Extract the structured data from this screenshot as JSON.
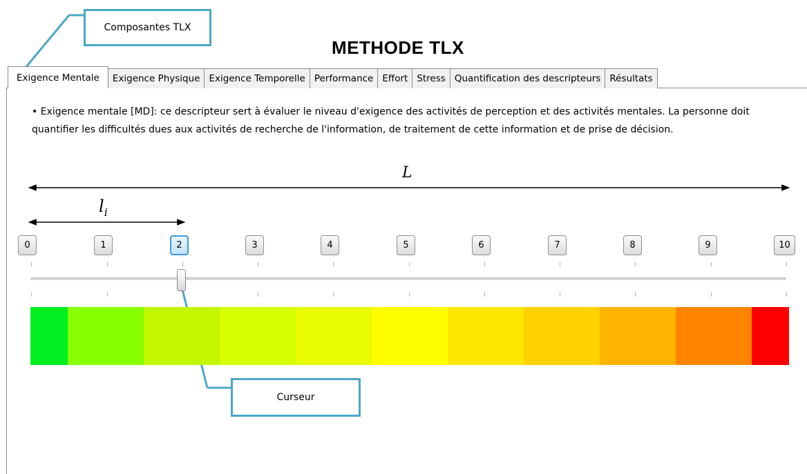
{
  "title": "METHODE TLX",
  "callouts": {
    "tlx_components": "Composantes TLX",
    "cursor": "Curseur"
  },
  "tabs": [
    {
      "label": "Exigence Mentale",
      "active": true
    },
    {
      "label": "Exigence Physique",
      "active": false
    },
    {
      "label": "Exigence Temporelle",
      "active": false
    },
    {
      "label": "Performance",
      "active": false
    },
    {
      "label": "Effort",
      "active": false
    },
    {
      "label": "Stress",
      "active": false
    },
    {
      "label": "Quantification des descripteurs",
      "active": false
    },
    {
      "label": "Résultats",
      "active": false
    }
  ],
  "description": "• Exigence mentale [MD]: ce descripteur sert à évaluer le niveau d'exigence des activités de perception et des activités mentales. La personne doit quantifier les difficultés dues aux activités de recherche de l'information, de traitement de cette information et de prise de décision.",
  "annotations": {
    "total_length": "L",
    "partial_length_base": "l",
    "partial_length_sub": "i"
  },
  "scale": {
    "labels": [
      "0",
      "1",
      "2",
      "3",
      "4",
      "5",
      "6",
      "7",
      "8",
      "9",
      "10"
    ],
    "selected": "2",
    "slider_value": 2,
    "slider_min": 0,
    "slider_max": 10
  },
  "colors": {
    "accent": "#4aa8c8",
    "selected_border": "#3c9ad8",
    "gradient": [
      "#00ee22",
      "#88ff00",
      "#c2f700",
      "#d6ff00",
      "#e8fb00",
      "#ffff00",
      "#ffe600",
      "#ffd200",
      "#ffb400",
      "#ff8400",
      "#ff0000"
    ]
  }
}
